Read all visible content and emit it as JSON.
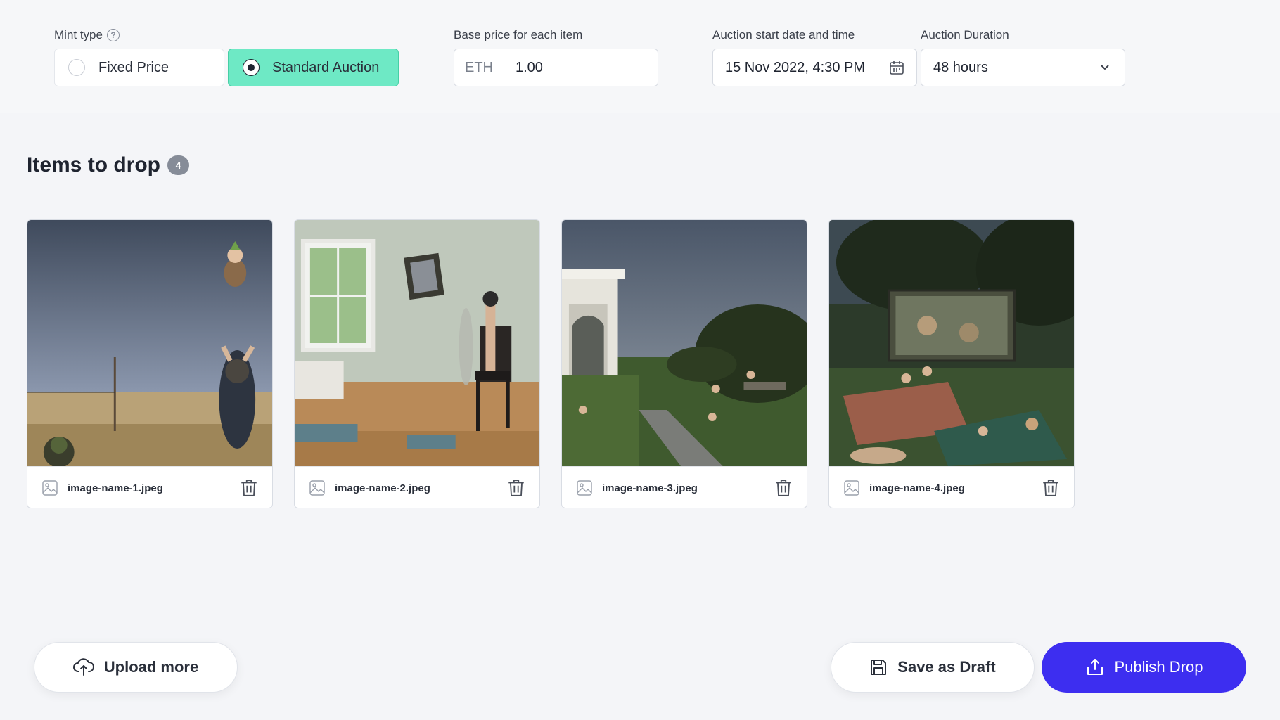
{
  "config": {
    "mint_type": {
      "label": "Mint type",
      "options": [
        {
          "label": "Fixed Price",
          "selected": false
        },
        {
          "label": "Standard Auction",
          "selected": true
        }
      ]
    },
    "base_price": {
      "label": "Base price for each item",
      "currency": "ETH",
      "value": "1.00"
    },
    "auction_start": {
      "label": "Auction start date and time",
      "value": "15 Nov 2022, 4:30 PM"
    },
    "auction_duration": {
      "label": "Auction Duration",
      "value": "48 hours"
    }
  },
  "items": {
    "title": "Items to drop",
    "count": "4",
    "list": [
      {
        "file_name": "image-name-1.jpeg"
      },
      {
        "file_name": "image-name-2.jpeg"
      },
      {
        "file_name": "image-name-3.jpeg"
      },
      {
        "file_name": "image-name-4.jpeg"
      }
    ]
  },
  "actions": {
    "upload_label": "Upload more",
    "draft_label": "Save as Draft",
    "publish_label": "Publish Drop"
  },
  "colors": {
    "accent_selected": "#6ee9c5",
    "publish": "#3d2ef0",
    "page_bg": "#f4f5f8"
  }
}
